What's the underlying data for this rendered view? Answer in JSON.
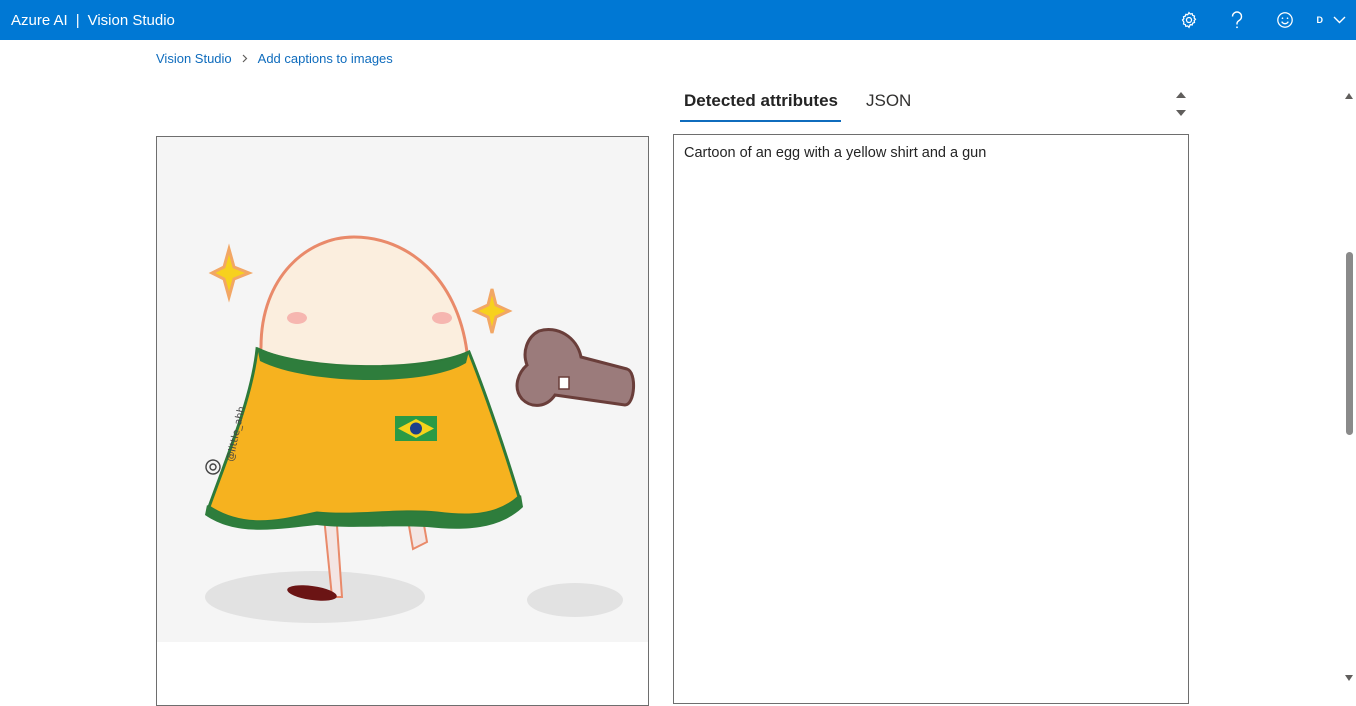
{
  "header": {
    "brand": "Azure AI",
    "separator": "|",
    "product": "Vision Studio",
    "avatar_letter": "D",
    "icons": [
      "settings-icon",
      "help-icon",
      "feedback-smiley-icon",
      "chevron-down-icon"
    ]
  },
  "breadcrumb": {
    "items": [
      "Vision Studio",
      "Add captions to images"
    ]
  },
  "tabs": [
    {
      "label": "Detected attributes",
      "active": true
    },
    {
      "label": "JSON",
      "active": false
    }
  ],
  "result": {
    "caption": "Cartoon of an egg with a yellow shirt and a gun"
  },
  "image": {
    "watermark": "@little_ahh"
  },
  "colors": {
    "header_bg": "#0078d4",
    "link": "#0f6cbd",
    "tab_underline": "#0f6cbd"
  }
}
